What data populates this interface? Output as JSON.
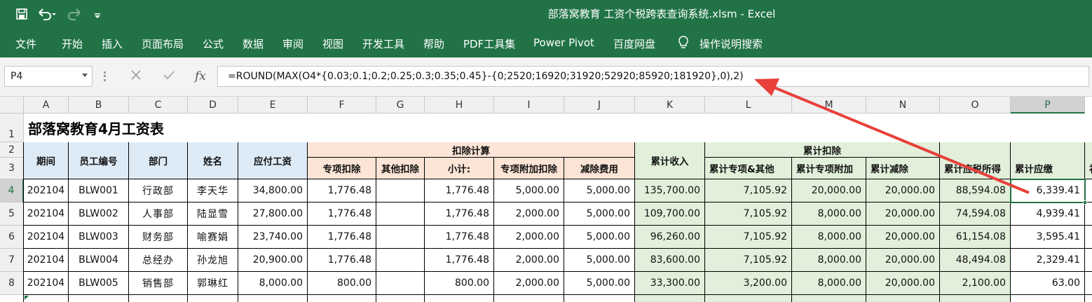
{
  "window": {
    "title": "部落窝教育  工资个税跨表查询系统.xlsm  -  Excel"
  },
  "icons": {
    "save": "save-icon",
    "undo": "undo-icon",
    "redo": "redo-icon",
    "customize": "customize-qat-icon",
    "lightbulb": "lightbulb-icon",
    "cancel": "cancel-x-icon",
    "confirm": "check-icon",
    "fx": "fx-icon"
  },
  "colors": {
    "excel_green": "#217346",
    "header_blue": "#ddebf7",
    "header_peach": "#fce4d6",
    "header_green": "#e2efda",
    "arrow_red": "#e8403a"
  },
  "ribbon": {
    "tabs": [
      "文件",
      "开始",
      "插入",
      "页面布局",
      "公式",
      "数据",
      "审阅",
      "视图",
      "开发工具",
      "帮助",
      "PDF工具集",
      "Power Pivot",
      "百度网盘"
    ],
    "search": "操作说明搜索"
  },
  "formula_bar": {
    "name_box": "P4",
    "fx_label": "fx",
    "formula": "=ROUND(MAX(O4*{0.03;0.1;0.2;0.25;0.3;0.35;0.45}-{0;2520;16920;31920;52920;85920;181920},0),2)"
  },
  "sheet": {
    "columns": [
      "A",
      "B",
      "C",
      "D",
      "E",
      "F",
      "G",
      "H",
      "I",
      "J",
      "K",
      "L",
      "M",
      "N",
      "O",
      "P"
    ],
    "rows": [
      "1",
      "2",
      "3",
      "4",
      "5",
      "6",
      "7",
      "8"
    ],
    "title": "部落窝教育4月工资表",
    "group_headers": {
      "deduction_calc": "扣除计算",
      "cumulative_deduction": "累计扣除"
    },
    "headers": {
      "A": "期间",
      "B": "员工编号",
      "C": "部门",
      "D": "姓名",
      "E": "应付工资",
      "F": "专项扣除",
      "G": "其他扣除",
      "H": "小计:",
      "I": "专项附加扣除",
      "J": "减除费用",
      "K": "累计收入",
      "L": "累计专项&其他",
      "M": "累计专项附加",
      "N": "累计减除",
      "O": "累计应税所得",
      "P": "累计应缴",
      "Q": "补"
    },
    "data": [
      [
        "202104",
        "BLW001",
        "行政部",
        "李天华",
        "34,800.00",
        "1,776.48",
        "",
        "1,776.48",
        "5,000.00",
        "5,000.00",
        "135,700.00",
        "7,105.92",
        "20,000.00",
        "20,000.00",
        "88,594.08",
        "6,339.41"
      ],
      [
        "202104",
        "BLW002",
        "人事部",
        "陆显雪",
        "27,800.00",
        "1,776.48",
        "",
        "1,776.48",
        "2,000.00",
        "5,000.00",
        "109,700.00",
        "7,105.92",
        "8,000.00",
        "20,000.00",
        "74,594.08",
        "4,939.41"
      ],
      [
        "202104",
        "BLW003",
        "财务部",
        "喻赛娟",
        "23,740.00",
        "1,776.48",
        "",
        "1,776.48",
        "2,000.00",
        "5,000.00",
        "96,260.00",
        "7,105.92",
        "8,000.00",
        "20,000.00",
        "61,154.08",
        "3,595.41"
      ],
      [
        "202104",
        "BLW004",
        "总经办",
        "孙龙旭",
        "20,900.00",
        "1,776.48",
        "",
        "1,776.48",
        "2,000.00",
        "5,000.00",
        "83,600.00",
        "7,105.92",
        "8,000.00",
        "20,000.00",
        "48,494.08",
        "2,329.41"
      ],
      [
        "202104",
        "BLW005",
        "销售部",
        "郭琳红",
        "8,000.00",
        "800.00",
        "",
        "800.00",
        "2,000.00",
        "5,000.00",
        "33,300.00",
        "3,200.00",
        "8,000.00",
        "20,000.00",
        "2,100.00",
        "63.00"
      ]
    ]
  }
}
